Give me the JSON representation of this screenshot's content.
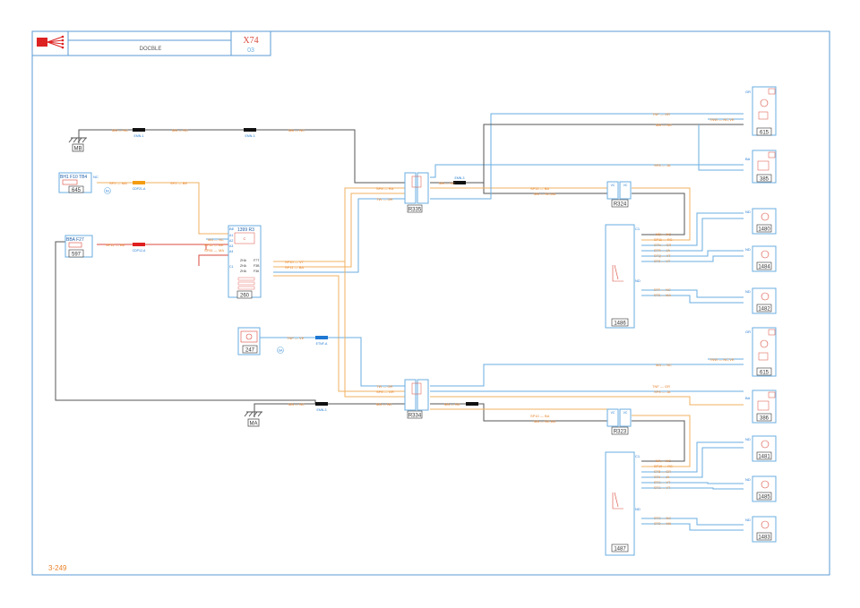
{
  "title_block": {
    "label": "DOCBLE",
    "sheet_code": "X74",
    "sheet_number": "03",
    "page_ref": "3-249"
  },
  "colors": {
    "frame": "#5b9bd5",
    "wire_blue": "#6aaee0",
    "wire_orange": "#f0b060",
    "wire_gray": "#555555",
    "label_orange": "#e8832a",
    "label_red": "#d94a3c",
    "connector_black": "#111111",
    "connector_orange": "#f39c12",
    "connector_red": "#e02020",
    "connector_blue": "#1f78d1"
  },
  "grounds": [
    {
      "id": "MB"
    },
    {
      "id": "MA"
    }
  ],
  "components": {
    "c645": {
      "id": "645",
      "header": "BH1 F10 TB4"
    },
    "c597": {
      "id": "597",
      "header": "BBA F27"
    },
    "c260": {
      "id": "260",
      "header": "1399 R3",
      "pins": [
        "A1",
        "A2",
        "A3",
        "A4",
        "C1",
        "D1",
        "D2",
        "D3",
        "D4"
      ],
      "inner": [
        "C",
        "ZHA",
        "ZHA",
        "ZHA",
        "F7T",
        "F3B",
        "F36"
      ]
    },
    "c247": {
      "id": "247"
    },
    "r335": {
      "id": "R335"
    },
    "r334": {
      "id": "R334"
    },
    "r324": {
      "id": "R324"
    },
    "r323": {
      "id": "R323"
    },
    "c1486": {
      "id": "1486"
    },
    "c1487": {
      "id": "1487"
    },
    "c615a": {
      "id": "615"
    },
    "c385a": {
      "id": "385"
    },
    "c615b": {
      "id": "615"
    },
    "c385b": {
      "id": "386"
    },
    "c1480": {
      "id": "1480"
    },
    "c1484": {
      "id": "1484"
    },
    "c1482": {
      "id": "1482"
    },
    "c1481": {
      "id": "1481"
    },
    "c1485": {
      "id": "1485"
    },
    "c1483": {
      "id": "1483"
    }
  },
  "connectors": {
    "emn1": "EMN-1",
    "emn2": "EMN-3",
    "emn3": "EMN-3",
    "emn4": "EMN-3",
    "orange_bus": "CDP21-A",
    "red_bus": "CDP12-A",
    "blue_bus": "ETNF-A"
  },
  "wire_labels": {
    "mb1": "MB — NC",
    "mb2": "MB — NC",
    "mb3": "MB — NC",
    "ma1": "MA — NC",
    "ma2": "MA — NC",
    "sp2a": "SP2 — MA",
    "sp2b": "SP2 — BE",
    "sp12": "SP12 — BE",
    "ma_a1": "MA — NC",
    "sp12_a3": "SP12 — BE",
    "sp81": "SP81 — MA",
    "sp10": "SP10 — VT",
    "sp11": "SP11 — BA",
    "sp8": "SP8 — RA",
    "tw1": "TW — GR",
    "tnf": "TNF — VE",
    "tnf_gr": "TNF — GR",
    "tnw": "TNW — NC,VE",
    "mb_nc": "MB — NC",
    "sp8_ja": "SP8 — JA",
    "sp11_ba": "SP11 — BA",
    "mb_nc_ba": "MB — NC,BA",
    "r335_mb": "MB — NC",
    "ma_nc": "MA — NC",
    "tnf_gr2": "TNF — GR",
    "sp8_ja2": "SP8 — JA",
    "tnw2": "TNW — NC,VE",
    "sp8_gr": "SP8 — GR",
    "tw2": "TW — GR",
    "sp10_ba": "SP10 — BA",
    "ma_nc_ba": "MA — NC,BA",
    "r334_ma": "MA — NC"
  },
  "seat1_wires": [
    "MB — NC",
    "SP11 — RG",
    "STN — GR",
    "STR — JA",
    "STQ — VT",
    "STS — VT",
    "STF — NC",
    "STE — MA"
  ],
  "seat2_wires": [
    "MA — NC",
    "SP10 — RG",
    "STB — GR",
    "STA — JA",
    "STC — VT",
    "STC — VT",
    "STC — NC",
    "STD — MA"
  ],
  "tags": {
    "nc": "NC",
    "vc": "VC",
    "gr": "GR",
    "ba": "BA",
    "be": "BE",
    "c1": "C1",
    "nd": "ND",
    "n3": "N3",
    "ga": "GA"
  }
}
